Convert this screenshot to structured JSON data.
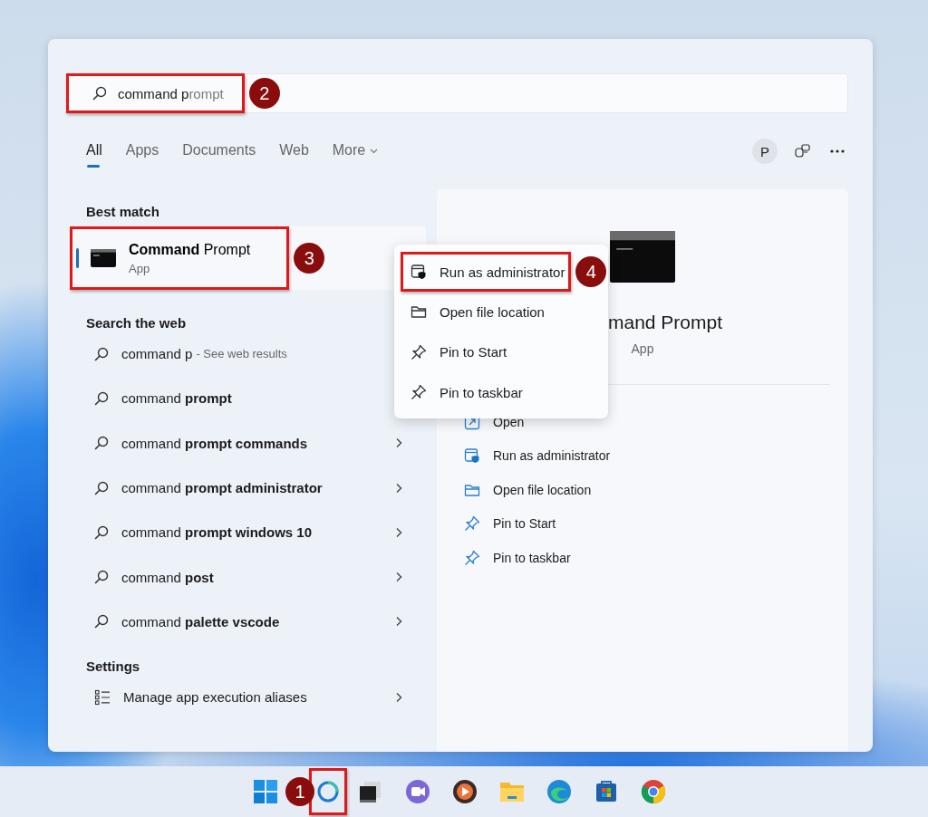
{
  "search": {
    "typed": "command p",
    "suggestion": "rompt",
    "callout": "2"
  },
  "tabs": [
    {
      "label": "All",
      "selected": true,
      "dropdown": false
    },
    {
      "label": "Apps",
      "selected": false,
      "dropdown": false
    },
    {
      "label": "Documents",
      "selected": false,
      "dropdown": false
    },
    {
      "label": "Web",
      "selected": false,
      "dropdown": false
    },
    {
      "label": "More",
      "selected": false,
      "dropdown": true
    }
  ],
  "account": {
    "initial": "P"
  },
  "best_match": {
    "heading": "Best match",
    "item": {
      "name": "**Command** Prompt",
      "type": "App",
      "selected": true,
      "callout": "3"
    }
  },
  "web": {
    "heading": "Search the web",
    "items": [
      {
        "text": "command p",
        "hint": "- See web results"
      },
      {
        "text": "command **prompt**"
      },
      {
        "text": "command **prompt commands**",
        "arrow": true
      },
      {
        "text": "command **prompt administrator**",
        "arrow": true
      },
      {
        "text": "command **prompt windows 10**",
        "arrow": true
      },
      {
        "text": "command **post**",
        "arrow": true
      },
      {
        "text": "command **palette vscode**",
        "arrow": true
      }
    ]
  },
  "settings": {
    "heading": "Settings",
    "items": [
      {
        "text": "Manage app execution aliases",
        "arrow": true
      }
    ]
  },
  "details": {
    "title": "mand Prompt",
    "subtitle": "App",
    "actions": [
      {
        "label": "Open",
        "kind": "open"
      },
      {
        "label": "Run as administrator",
        "kind": "admin"
      },
      {
        "label": "Open file location",
        "kind": "folder"
      },
      {
        "label": "Pin to Start",
        "kind": "pin"
      },
      {
        "label": "Pin to taskbar",
        "kind": "pin"
      }
    ]
  },
  "context_menu": {
    "items": [
      {
        "label": "Run as administrator",
        "kind": "admin",
        "callout": "4"
      },
      {
        "label": "Open file location",
        "kind": "folder"
      },
      {
        "label": "Pin to Start",
        "kind": "pin"
      },
      {
        "label": "Pin to taskbar",
        "kind": "pin"
      }
    ]
  },
  "taskbar": {
    "items": [
      {
        "kind": "start"
      },
      {
        "kind": "search",
        "callout": "1"
      },
      {
        "kind": "task-view"
      },
      {
        "kind": "chat"
      },
      {
        "kind": "media"
      },
      {
        "kind": "folder"
      },
      {
        "kind": "browser"
      },
      {
        "kind": "store"
      },
      {
        "kind": "chrome"
      }
    ]
  }
}
